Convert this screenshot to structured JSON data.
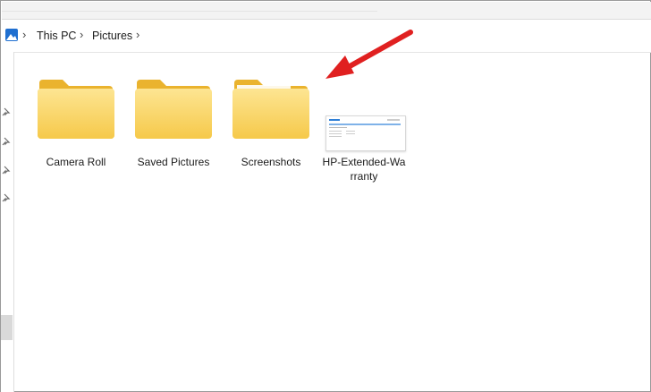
{
  "breadcrumb": {
    "items": [
      {
        "label": "This PC"
      },
      {
        "label": "Pictures"
      }
    ],
    "separator": ">"
  },
  "items": [
    {
      "name": "Camera Roll",
      "type": "folder"
    },
    {
      "name": "Saved Pictures",
      "type": "folder"
    },
    {
      "name": "Screenshots",
      "type": "folder"
    },
    {
      "name_line1": "HP-Extended-Wa",
      "name_line2": "rranty",
      "type": "image"
    }
  ],
  "colors": {
    "folder_front": "#f9d35f",
    "folder_back": "#eab32e",
    "arrow": "#e02020",
    "thumb_accent": "#2f7fd6"
  }
}
